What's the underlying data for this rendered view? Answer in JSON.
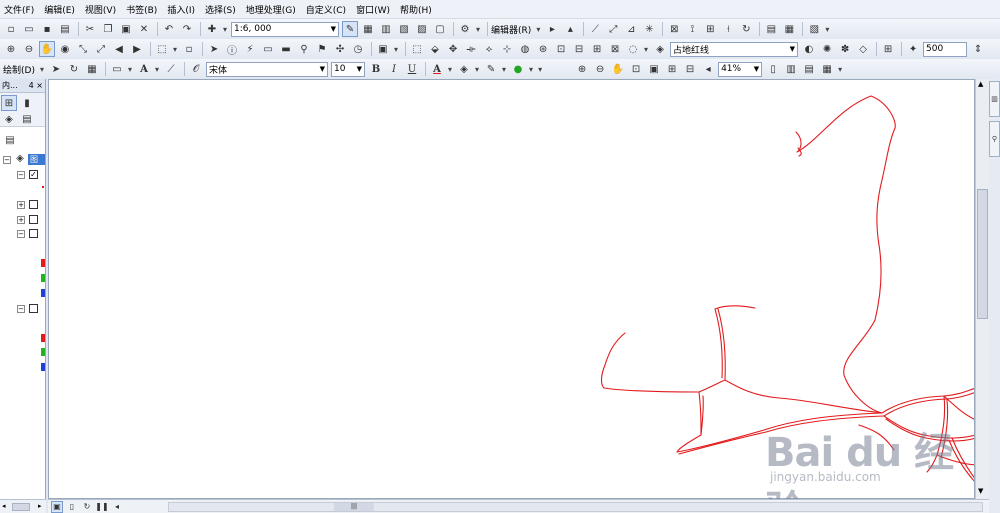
{
  "menu": [
    "文件(F)",
    "编辑(E)",
    "视图(V)",
    "书签(B)",
    "插入(I)",
    "选择(S)",
    "地理处理(G)",
    "自定义(C)",
    "窗口(W)",
    "帮助(H)"
  ],
  "toolbar": {
    "scale_value": "1:6, 000",
    "editor_label": "编辑器(R)",
    "layer_combo": "占地红线",
    "zoom_value": "500",
    "draw_label": "绘制(D)",
    "font_name": "宋体",
    "font_size": "10",
    "bold_label": "B",
    "italic_label": "I",
    "underline_label": "U",
    "font_color_label": "A",
    "percent_value": "41%"
  },
  "toc": {
    "title": "内...",
    "pin": "4",
    "close": "×",
    "root_label": "图层"
  },
  "watermark": {
    "main": "Bai du 经验",
    "url": "jingyan.baidu.com"
  },
  "colors": {
    "road_lines": "#e31a1c",
    "selection": "#3b78d0"
  },
  "icons": {
    "pan": "hand-icon",
    "identify": "info-icon",
    "zoom_in": "zoom-in-icon",
    "zoom_out": "zoom-out-icon"
  }
}
